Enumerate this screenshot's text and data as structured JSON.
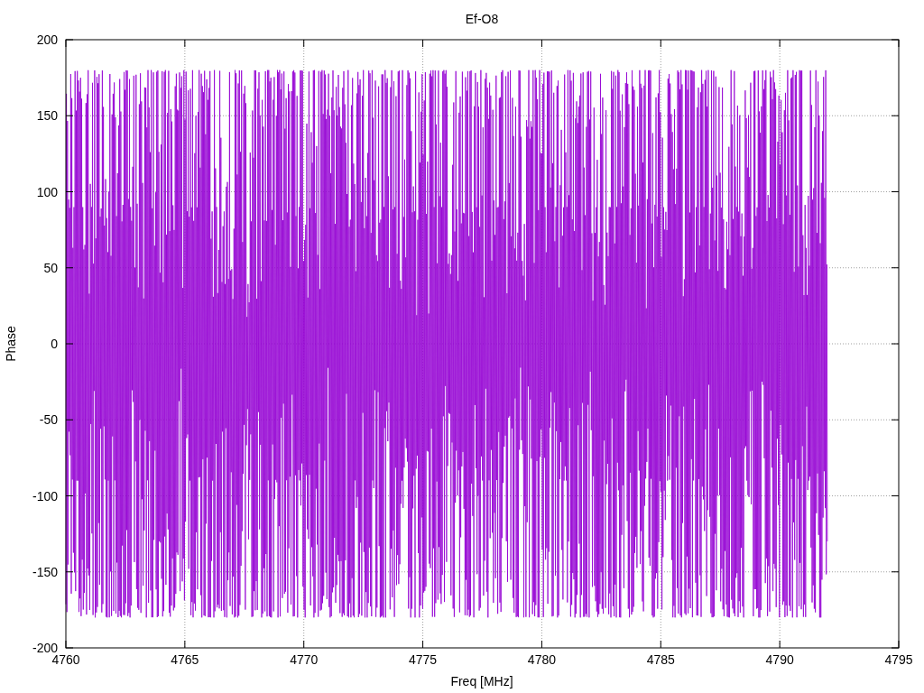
{
  "plot": {
    "title": "Ef-O8",
    "xlabel": "Freq [MHz]",
    "ylabel": "Phase",
    "xticks": [
      "4760",
      "4765",
      "4770",
      "4775",
      "4780",
      "4785",
      "4790",
      "4795"
    ],
    "yticks": [
      "200",
      "150",
      "100",
      "50",
      "0",
      "-50",
      "-100",
      "-150",
      "-200"
    ]
  }
}
